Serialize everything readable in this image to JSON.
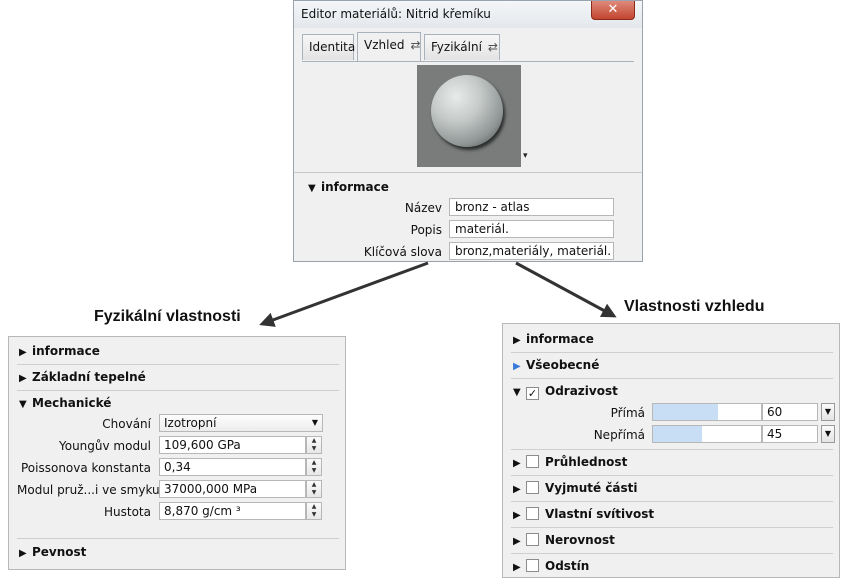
{
  "editor": {
    "title": "Editor materiálů: Nitrid křemíku",
    "close_glyph": "✕",
    "tabs": [
      {
        "label": "Identita",
        "icon": ""
      },
      {
        "label": "Vzhled",
        "icon": "⇄"
      },
      {
        "label": "Fyzikální",
        "icon": "⇄"
      }
    ],
    "preview_dropdown": "▾",
    "info_header": "informace",
    "props": [
      {
        "label": "Název",
        "value": "bronz - atlas"
      },
      {
        "label": "Popis",
        "value": " materiál."
      },
      {
        "label": "Klíčová slova",
        "value": "bronz,materiály, materiál."
      }
    ]
  },
  "captions": {
    "physical": "Fyzikální vlastnosti",
    "appearance": "Vlastnosti vzhledu"
  },
  "physical_panel": {
    "sections": {
      "info": "informace",
      "thermal": "Základní tepelné",
      "mechanical": "Mechanické",
      "strength": "Pevnost"
    },
    "rows": [
      {
        "label": "Chování",
        "value": "Izotropní"
      },
      {
        "label": "Youngův modul",
        "value": "109,600 GPa"
      },
      {
        "label": "Poissonova konstanta",
        "value": "0,34"
      },
      {
        "label": "Modul pruž...i ve smyku",
        "value": "37000,000 MPa"
      },
      {
        "label": "Hustota",
        "value": "8,870 g/cm ³"
      }
    ]
  },
  "appearance_panel": {
    "sections": {
      "info": "informace",
      "general": "Všeobecné",
      "reflectivity": "Odrazivost",
      "transparency": "Průhlednost",
      "cutout": "Vyjmuté části",
      "self_illum": "Vlastní svítivost",
      "bump": "Nerovnost",
      "tint": "Odstín"
    },
    "reflect_checked": "✓",
    "rows": [
      {
        "label": "Přímá",
        "value": "60",
        "fraction": 0.6
      },
      {
        "label": "Nepřímá",
        "value": "45",
        "fraction": 0.45
      }
    ]
  },
  "colors": {
    "window_bg": "#f0f0f0",
    "close_button": "#c2452f",
    "slider_fill": "#c7def4",
    "accent_triangle": "#3a7ad8"
  }
}
